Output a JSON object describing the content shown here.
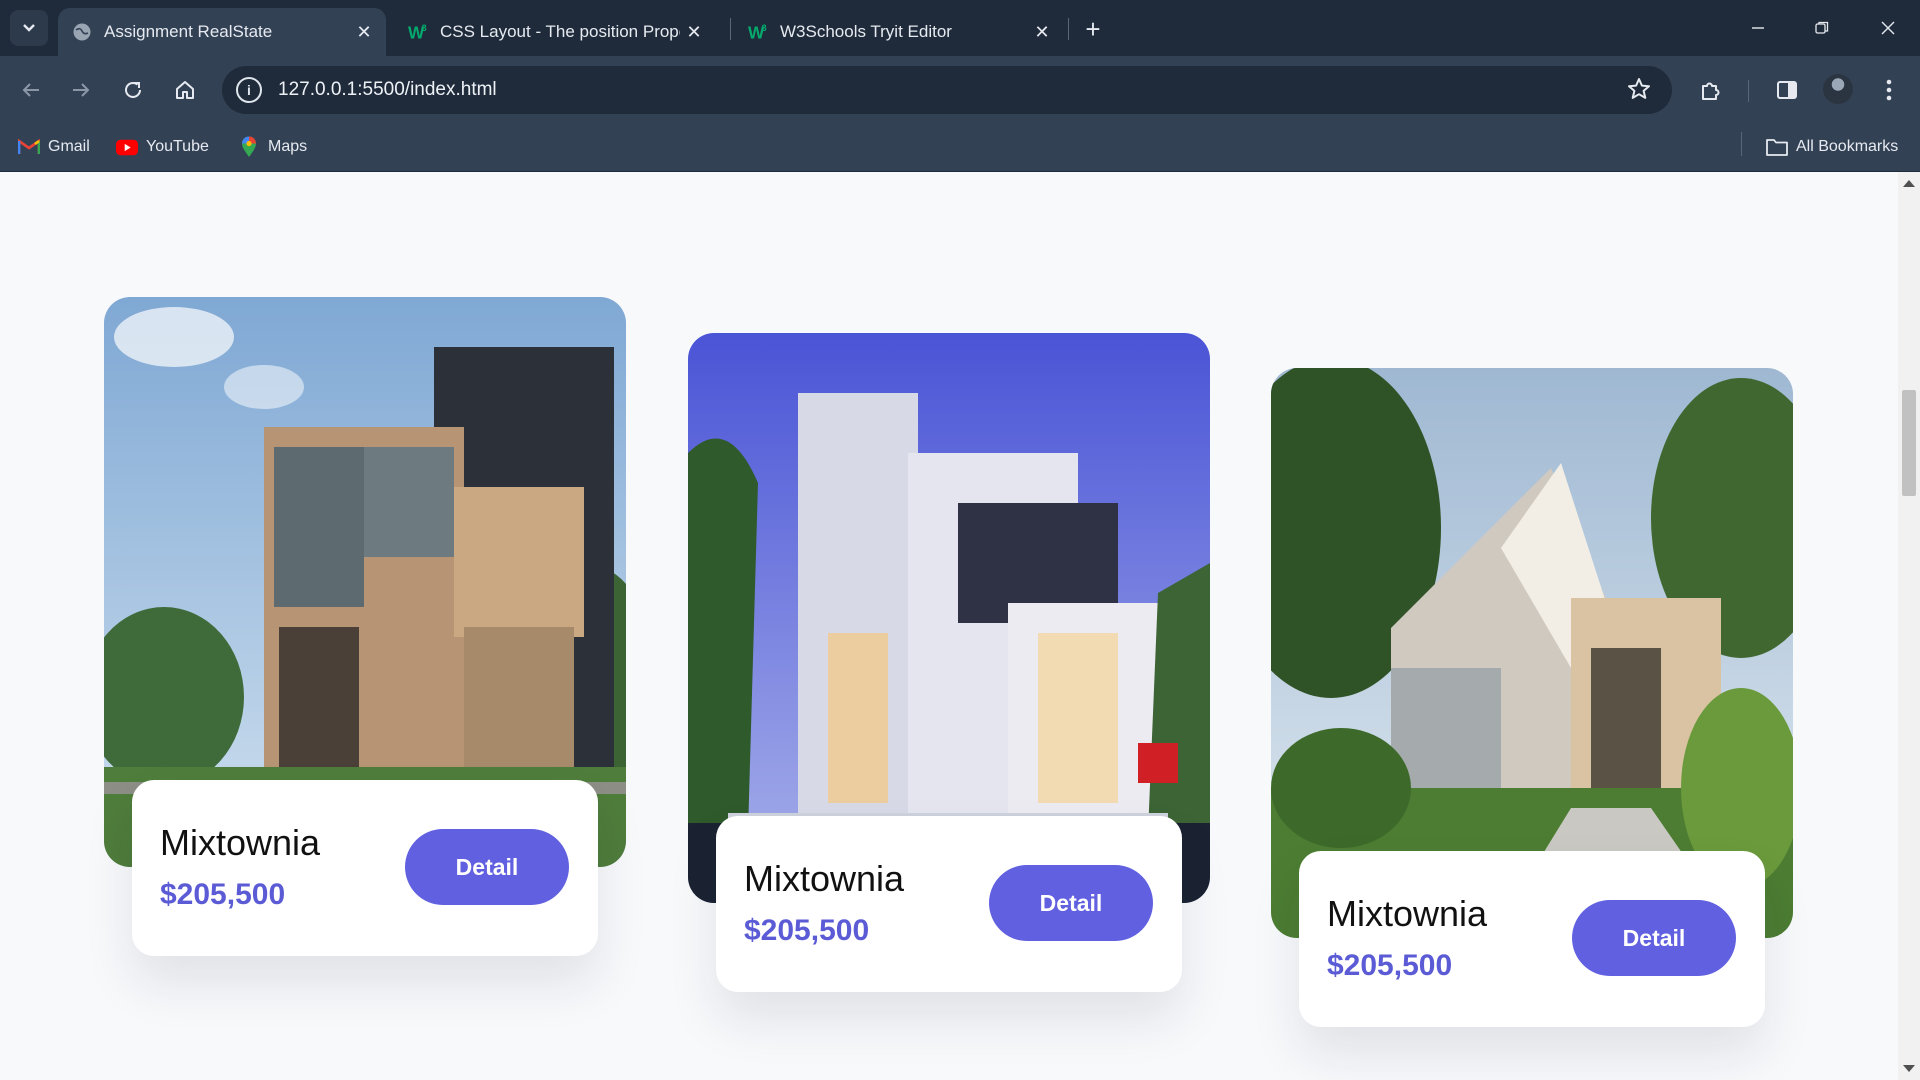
{
  "browser": {
    "tabs": [
      {
        "title": "Assignment RealState",
        "active": true
      },
      {
        "title": "CSS Layout - The position Property",
        "active": false
      },
      {
        "title": "W3Schools Tryit Editor",
        "active": false
      }
    ],
    "url": "127.0.0.1:5500/index.html",
    "bookmarks": [
      {
        "label": "Gmail",
        "icon": "gmail-icon"
      },
      {
        "label": "YouTube",
        "icon": "youtube-icon"
      },
      {
        "label": "Maps",
        "icon": "maps-icon"
      }
    ],
    "all_bookmarks_label": "All Bookmarks"
  },
  "listings": [
    {
      "name": "Mixtownia",
      "price": "$205,500",
      "button": "Detail",
      "image": "modern-wood-house-photo"
    },
    {
      "name": "Mixtownia",
      "price": "$205,500",
      "button": "Detail",
      "image": "white-villa-palm-photo"
    },
    {
      "name": "Mixtownia",
      "price": "$205,500",
      "button": "Detail",
      "image": "garden-cottage-photo"
    }
  ],
  "colors": {
    "accent": "#6160e0",
    "price": "#5b5bd6",
    "page_bg": "#f8f9fb",
    "chrome_dark": "#1f2b3a",
    "chrome": "#334155"
  }
}
